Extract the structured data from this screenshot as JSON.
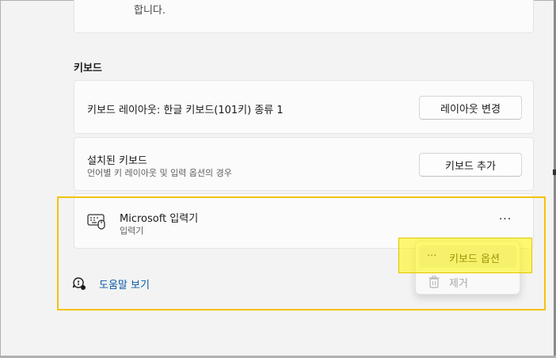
{
  "top_card": {
    "text": "합니다."
  },
  "keyboard_section": {
    "title": "키보드"
  },
  "layout_row": {
    "label": "키보드 레이아웃: 한글 키보드(101키) 종류 1",
    "button": "레이아웃 변경"
  },
  "installed_row": {
    "label": "설치된 키보드",
    "sub": "언어별 키 레이아웃 및 입력 옵션의 경우",
    "button": "키보드 추가"
  },
  "ms_ime": {
    "name": "Microsoft 입력기",
    "sub": "입력기",
    "more": "···",
    "icon": "keyboard-icon"
  },
  "help": {
    "label": "도움말 보기",
    "icon": "help-icon"
  },
  "context_menu": {
    "items": [
      {
        "icon": "···",
        "label": "키보드 옵션"
      },
      {
        "icon": "trash-icon",
        "label": "제거"
      }
    ]
  },
  "colors": {
    "accent_link": "#0a5aa7",
    "highlight": "#fff600",
    "outline": "#f4c20d"
  }
}
